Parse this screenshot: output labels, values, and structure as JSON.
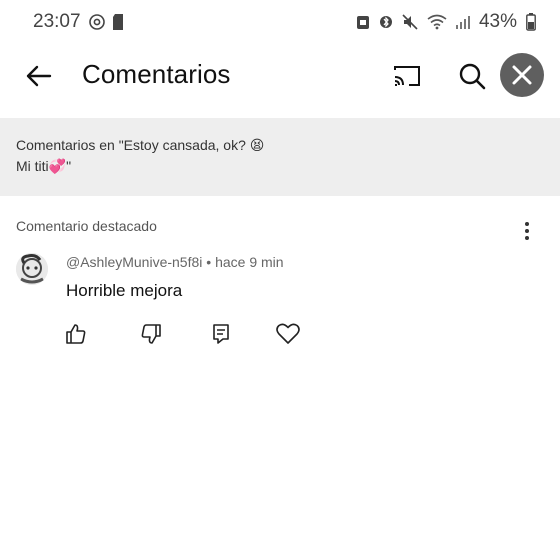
{
  "status_bar": {
    "time": "23:07",
    "battery": "43%",
    "icons": [
      "at-sign-icon",
      "sd-card-icon",
      "alarm-icon",
      "bluetooth-icon",
      "mute-icon",
      "wifi-icon",
      "signal-icon",
      "battery-icon"
    ]
  },
  "app_bar": {
    "title": "Comentarios",
    "icons": [
      "back-arrow-icon",
      "cast-icon",
      "search-icon",
      "close-icon"
    ]
  },
  "context_banner": {
    "line1": "Comentarios en \"Estoy cansada, ok? 😫",
    "line2": "Mi titi💞\""
  },
  "section": {
    "label": "Comentario destacado"
  },
  "comment": {
    "author": "@AshleyMunive-n5f8i",
    "separator": "•",
    "time": "hace 9 min",
    "text": "Horrible mejora"
  },
  "colors": {
    "banner_bg": "#eeeeee",
    "close_bg": "#5f5f5f",
    "text": "#0f0f0f",
    "secondary": "#666666"
  }
}
